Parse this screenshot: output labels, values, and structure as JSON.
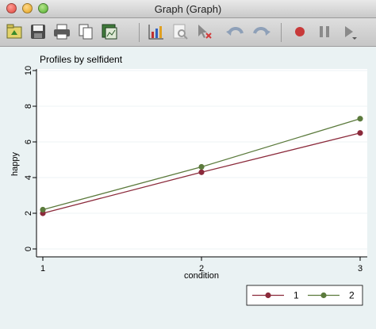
{
  "window": {
    "title": "Graph (Graph)"
  },
  "toolbar": {
    "buttons": [
      {
        "name": "open-graph-icon"
      },
      {
        "name": "save-icon"
      },
      {
        "name": "print-icon"
      },
      {
        "name": "copy-icon"
      },
      {
        "name": "rename-graph-icon"
      },
      {
        "name": "graph-editor-icon"
      },
      {
        "name": "zoom-icon"
      },
      {
        "name": "pointer-icon"
      },
      {
        "name": "undo-icon"
      },
      {
        "name": "redo-icon"
      },
      {
        "name": "record-icon"
      },
      {
        "name": "pause-icon"
      },
      {
        "name": "play-icon"
      }
    ]
  },
  "colors": {
    "series1": "#8b2a3b",
    "series2": "#5b7a3c",
    "plot_bg": "#ffffff",
    "outer_bg": "#eaf2f3"
  },
  "chart_data": {
    "type": "line",
    "title": "Profiles by selfident",
    "xlabel": "condition",
    "ylabel": "happy",
    "x": [
      1,
      2,
      3
    ],
    "xticks": [
      "1",
      "2",
      "3"
    ],
    "yticks": [
      "0",
      "2",
      "4",
      "6",
      "8",
      "10"
    ],
    "ylim": [
      0,
      10
    ],
    "grid": true,
    "legend": "bottom-right",
    "series": [
      {
        "name": "1",
        "values": [
          2.0,
          4.3,
          6.5
        ]
      },
      {
        "name": "2",
        "values": [
          2.2,
          4.6,
          7.3
        ]
      }
    ]
  }
}
